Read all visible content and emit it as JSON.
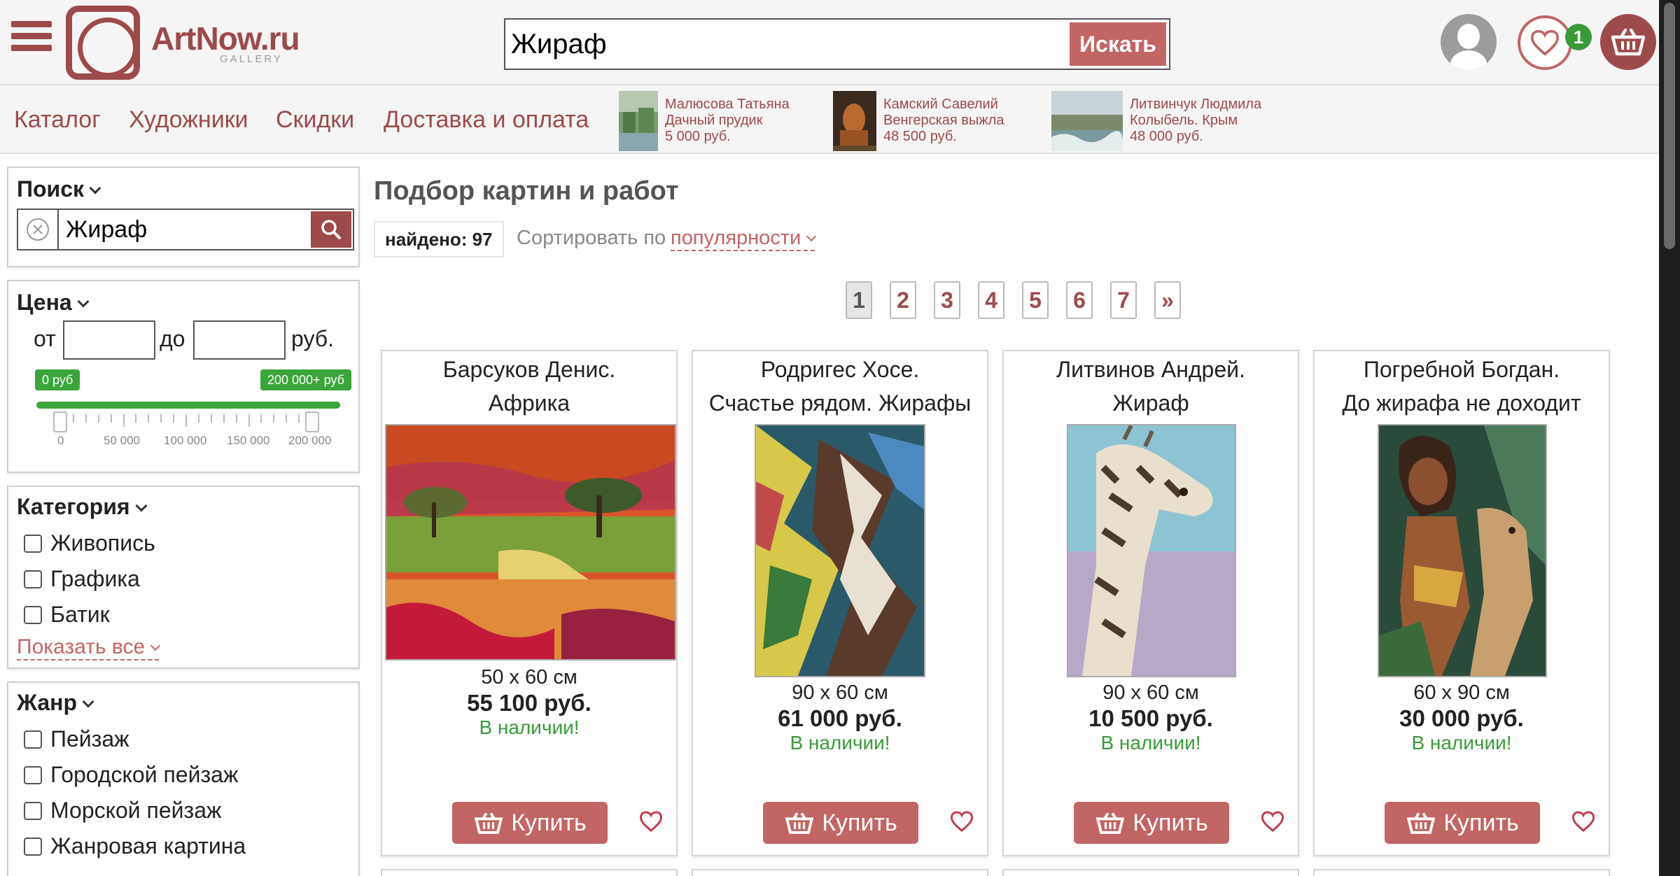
{
  "header": {
    "logo_text": "ArtNow.ru",
    "logo_sub": "GALLERY",
    "search_value": "Жираф",
    "search_button": "Искать",
    "favorites_count": "1",
    "brand_color": "#9d4a4a",
    "accent_color": "#c26565"
  },
  "nav": {
    "links": [
      "Каталог",
      "Художники",
      "Скидки",
      "Доставка и оплата"
    ],
    "promos": [
      {
        "artist": "Малюсова Татьяна",
        "title": "Дачный прудик",
        "price": "5 000 руб."
      },
      {
        "artist": "Камский Савелий",
        "title": "Венгерская выжла",
        "price": "48 500 руб."
      },
      {
        "artist": "Литвинчук Людмила",
        "title": "Колыбель. Крым",
        "price": "48 000 руб."
      }
    ]
  },
  "sidebar": {
    "search": {
      "title": "Поиск",
      "value": "Жираф"
    },
    "price": {
      "title": "Цена",
      "from": "от",
      "to": "до",
      "currency": "руб.",
      "min_tag": "0 руб",
      "max_tag": "200 000+ руб",
      "ticks": [
        "0",
        "50 000",
        "100 000",
        "150 000",
        "200 000"
      ],
      "range_fraction": [
        0,
        1
      ]
    },
    "category": {
      "title": "Категория",
      "items": [
        "Живопись",
        "Графика",
        "Батик"
      ],
      "show_all": "Показать все"
    },
    "genre": {
      "title": "Жанр",
      "items": [
        "Пейзаж",
        "Городской пейзаж",
        "Морской пейзаж",
        "Жанровая картина"
      ]
    }
  },
  "main": {
    "title": "Подбор картин и работ",
    "found": "найдено: 97",
    "sort_label": "Сортировать по",
    "sort_value": "популярности",
    "pages": [
      "1",
      "2",
      "3",
      "4",
      "5",
      "6",
      "7",
      "»"
    ],
    "active_page": "1",
    "products": [
      {
        "artist": "Барсуков Денис.",
        "title": "Африка",
        "size": "50 x 60 см",
        "price": "55 100 руб.",
        "stock": "В наличии!",
        "buy": "Купить"
      },
      {
        "artist": "Родригес Хосе.",
        "title": "Счастье рядом. Жирафы",
        "size": "90 x 60 см",
        "price": "61 000 руб.",
        "stock": "В наличии!",
        "buy": "Купить"
      },
      {
        "artist": "Литвинов Андрей.",
        "title": "Жираф",
        "size": "90 x 60 см",
        "price": "10 500 руб.",
        "stock": "В наличии!",
        "buy": "Купить"
      },
      {
        "artist": "Погребной Богдан.",
        "title": "До жирафа не доходит",
        "size": "60 x 90 см",
        "price": "30 000 руб.",
        "stock": "В наличии!",
        "buy": "Купить"
      }
    ]
  },
  "icons": [
    "menu-icon",
    "user-icon",
    "heart-icon",
    "basket-icon",
    "clear-icon",
    "search-icon",
    "chevron-down-icon"
  ]
}
